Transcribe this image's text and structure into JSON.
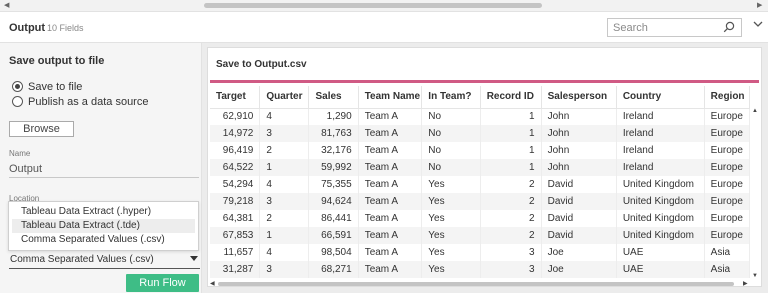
{
  "header": {
    "title": "Output",
    "fields_count": "10 Fields",
    "search_placeholder": "Search"
  },
  "left_panel": {
    "heading": "Save output to file",
    "radio_save": "Save to file",
    "radio_publish": "Publish as a data source",
    "browse_label": "Browse",
    "name_label": "Name",
    "name_value": "Output",
    "location_label": "Location",
    "type_options": [
      "Tableau Data Extract (.hyper)",
      "Tableau Data Extract (.tde)",
      "Comma Separated Values (.csv)"
    ],
    "selected_type": "Comma Separated Values (.csv)",
    "run_button": "Run Flow"
  },
  "preview": {
    "title": "Save to Output.csv",
    "accent_color": "#d05a84",
    "columns": [
      "Target",
      "Quarter",
      "Sales",
      "Team Name",
      "In Team?",
      "Record ID",
      "Salesperson",
      "Country",
      "Region"
    ],
    "rows": [
      [
        "62,910",
        "4",
        "1,290",
        "Team A",
        "No",
        "1",
        "John",
        "Ireland",
        "Europe"
      ],
      [
        "14,972",
        "3",
        "81,763",
        "Team A",
        "No",
        "1",
        "John",
        "Ireland",
        "Europe"
      ],
      [
        "96,419",
        "2",
        "32,176",
        "Team A",
        "No",
        "1",
        "John",
        "Ireland",
        "Europe"
      ],
      [
        "64,522",
        "1",
        "59,992",
        "Team A",
        "No",
        "1",
        "John",
        "Ireland",
        "Europe"
      ],
      [
        "54,294",
        "4",
        "75,355",
        "Team A",
        "Yes",
        "2",
        "David",
        "United Kingdom",
        "Europe"
      ],
      [
        "79,218",
        "3",
        "94,624",
        "Team A",
        "Yes",
        "2",
        "David",
        "United Kingdom",
        "Europe"
      ],
      [
        "64,381",
        "2",
        "86,441",
        "Team A",
        "Yes",
        "2",
        "David",
        "United Kingdom",
        "Europe"
      ],
      [
        "67,853",
        "1",
        "66,591",
        "Team A",
        "Yes",
        "2",
        "David",
        "United Kingdom",
        "Europe"
      ],
      [
        "11,657",
        "4",
        "98,504",
        "Team A",
        "Yes",
        "3",
        "Joe",
        "UAE",
        "Asia"
      ],
      [
        "31,287",
        "3",
        "68,271",
        "Team A",
        "Yes",
        "3",
        "Joe",
        "UAE",
        "Asia"
      ]
    ]
  },
  "colors": {
    "run_button": "#3ebd86",
    "accent_bar": "#d05a84"
  }
}
